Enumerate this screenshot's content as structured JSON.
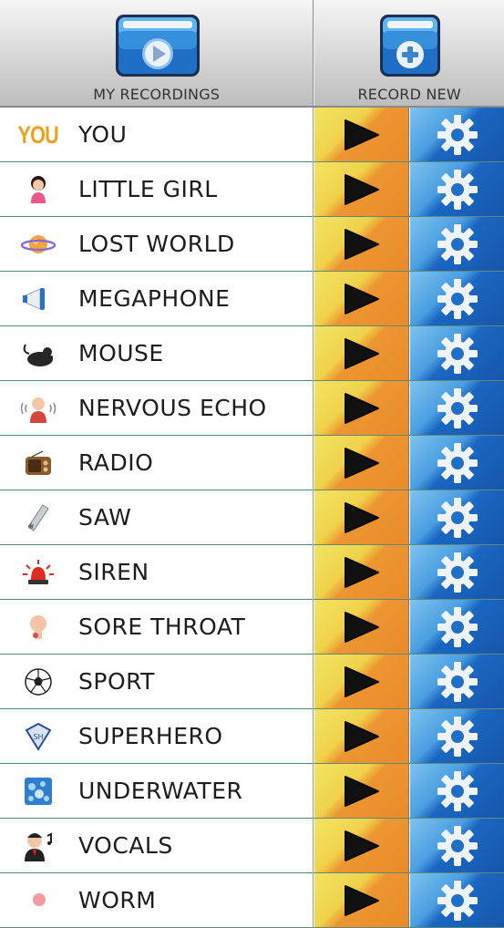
{
  "header": {
    "my_recordings_label": "MY RECORDINGS",
    "record_new_label": "RECORD NEW"
  },
  "colors": {
    "play_gradient": [
      "#f3e463",
      "#ea8a2a"
    ],
    "settings_gradient": [
      "#7ec3f0",
      "#1657ab"
    ],
    "folder_blue": "#1f74c8"
  },
  "recordings": [
    {
      "label": "YOU",
      "icon": "you-text-icon"
    },
    {
      "label": "LITTLE GIRL",
      "icon": "little-girl-icon"
    },
    {
      "label": "LOST WORLD",
      "icon": "planet-icon"
    },
    {
      "label": "MEGAPHONE",
      "icon": "megaphone-icon"
    },
    {
      "label": "MOUSE",
      "icon": "mouse-icon"
    },
    {
      "label": "NERVOUS ECHO",
      "icon": "nervous-person-icon"
    },
    {
      "label": "RADIO",
      "icon": "radio-icon"
    },
    {
      "label": "SAW",
      "icon": "saw-icon"
    },
    {
      "label": "SIREN",
      "icon": "siren-icon"
    },
    {
      "label": "SORE THROAT",
      "icon": "sore-throat-icon"
    },
    {
      "label": "SPORT",
      "icon": "soccer-ball-icon"
    },
    {
      "label": "SUPERHERO",
      "icon": "superhero-icon"
    },
    {
      "label": "UNDERWATER",
      "icon": "bubbles-icon"
    },
    {
      "label": "VOCALS",
      "icon": "singer-icon"
    },
    {
      "label": "WORM",
      "icon": "worm-icon"
    }
  ],
  "you_icon_text": "YOU"
}
